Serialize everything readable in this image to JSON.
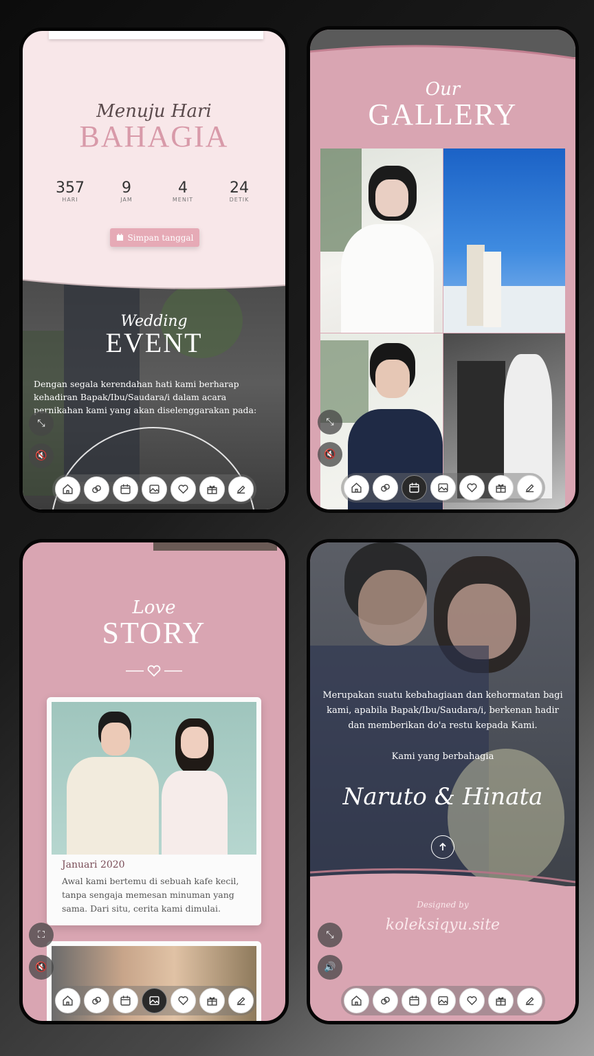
{
  "panel_countdown": {
    "script_title": "Menuju Hari",
    "main_title": "BAHAGIA",
    "countdown": [
      {
        "value": "357",
        "label": "HARI"
      },
      {
        "value": "9",
        "label": "JAM"
      },
      {
        "value": "4",
        "label": "MENIT"
      },
      {
        "value": "24",
        "label": "DETIK"
      }
    ],
    "save_date_label": "Simpan tanggal",
    "event_script": "Wedding",
    "event_title": "EVENT",
    "event_text": "Dengan segala kerendahan hati kami berharap kehadiran Bapak/Ibu/Saudara/i dalam acara pernikahan kami yang akan diselenggarakan pada:"
  },
  "panel_gallery": {
    "script_title": "Our",
    "main_title": "GALLERY"
  },
  "panel_story": {
    "script_title": "Love",
    "main_title": "STORY",
    "card_date": "Januari 2020",
    "card_text": "Awal kami bertemu di sebuah kafe kecil, tanpa sengaja memesan minuman yang sama. Dari situ, cerita kami dimulai."
  },
  "panel_closing": {
    "message": "Merupakan suatu kebahagiaan dan kehormatan bagi kami, apabila Bapak/Ibu/Saudara/i, berkenan hadir dan memberikan do'a restu kepada Kami.",
    "signoff": "Kami yang berbahagia",
    "couple": "Naruto & Hinata",
    "designed_by": "Designed by",
    "site": "koleksiqyu.site"
  },
  "nav_icons": [
    "home-icon",
    "rings-icon",
    "calendar-icon",
    "gallery-icon",
    "heart-icon",
    "gift-icon",
    "edit-icon"
  ],
  "active_nav": {
    "panel_countdown": -1,
    "panel_gallery": 2,
    "panel_story": 3,
    "panel_closing": -1
  },
  "colors": {
    "accent": "#d9a5b2",
    "title_pink": "#d89aa9",
    "cream": "#f8e7e9"
  }
}
